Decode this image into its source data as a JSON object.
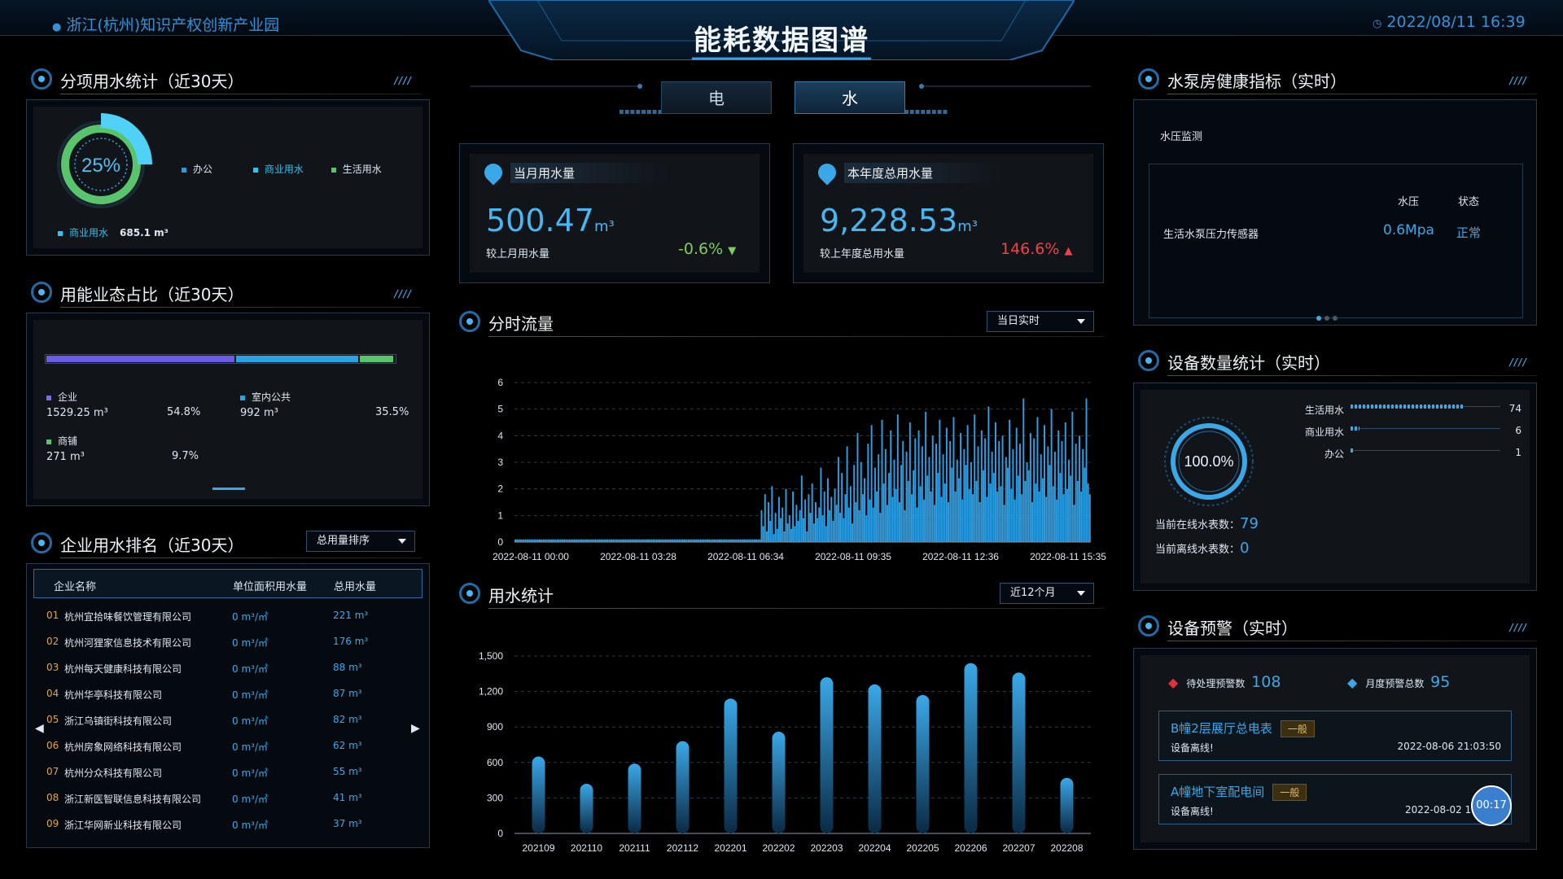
{
  "header": {
    "location": "浙江(杭州)知识产权创新产业园",
    "title": "能耗数据图谱",
    "datetime": "2022/08/11 16:39"
  },
  "tabs": [
    {
      "label": "电",
      "active": false
    },
    {
      "label": "水",
      "active": true
    }
  ],
  "sub_water": {
    "title": "分项用水统计（近30天）",
    "percent": "25%",
    "percent_value": 25,
    "legend": [
      {
        "label": "办公",
        "color": "#2f9ae0"
      },
      {
        "label": "商业用水",
        "color": "#2fc4ef"
      },
      {
        "label": "生活用水",
        "color": "#58c46c"
      }
    ],
    "detail_label": "商业用水",
    "detail_value": "685.1 m³"
  },
  "energy_ratio": {
    "title": "用能业态占比（近30天）",
    "bar_fractions": [
      0.548,
      0.355,
      0.097
    ],
    "bar_colors": [
      "#6a5ce8",
      "#2aa3e6",
      "#58c46c"
    ],
    "items": [
      {
        "label": "企业",
        "value": "1529.25 m³",
        "pct": "54.8%",
        "color": "#7a6ef0"
      },
      {
        "label": "室内公共",
        "value": "992 m³",
        "pct": "35.5%",
        "color": "#2aa3e6"
      },
      {
        "label": "商铺",
        "value": "271 m³",
        "pct": "9.7%",
        "color": "#58c46c"
      }
    ]
  },
  "ranking": {
    "title": "企业用水排名（近30天）",
    "sort_label": "总用量排序",
    "columns": [
      "企业名称",
      "单位面积用水量",
      "总用水量"
    ],
    "rows": [
      {
        "rank": "01",
        "name": "杭州宜拾味餐饮管理有限公司",
        "per_area": "0 m³/㎡",
        "total": "221 m³"
      },
      {
        "rank": "02",
        "name": "杭州河狸家信息技术有限公司",
        "per_area": "0 m³/㎡",
        "total": "176 m³"
      },
      {
        "rank": "03",
        "name": "杭州每天健康科技有限公司",
        "per_area": "0 m³/㎡",
        "total": "88 m³"
      },
      {
        "rank": "04",
        "name": "杭州华亭科技有限公司",
        "per_area": "0 m³/㎡",
        "total": "87 m³"
      },
      {
        "rank": "05",
        "name": "浙江乌镇街科技有限公司",
        "per_area": "0 m³/㎡",
        "total": "82 m³"
      },
      {
        "rank": "06",
        "name": "杭州房象网络科技有限公司",
        "per_area": "0 m³/㎡",
        "total": "62 m³"
      },
      {
        "rank": "07",
        "name": "杭州分众科技有限公司",
        "per_area": "0 m³/㎡",
        "total": "55 m³"
      },
      {
        "rank": "08",
        "name": "浙江新医智联信息科技有限公司",
        "per_area": "0 m³/㎡",
        "total": "41 m³"
      },
      {
        "rank": "09",
        "name": "浙江华网新业科技有限公司",
        "per_area": "0 m³/㎡",
        "total": "37 m³"
      }
    ]
  },
  "kpis": [
    {
      "label": "当月用水量",
      "value": "500.47",
      "unit": "m³",
      "compare_label": "较上月用水量",
      "change": "-0.6%",
      "change_color": "#7ccf5c",
      "arrow": "▼"
    },
    {
      "label": "本年度总用水量",
      "value": "9,228.53",
      "unit": "m³",
      "compare_label": "较上年度总用水量",
      "change": "146.6%",
      "change_color": "#f0404a",
      "arrow": "▲"
    }
  ],
  "hourly": {
    "title": "分时流量",
    "select_label": "当日实时"
  },
  "usage_stats": {
    "title": "用水统计",
    "select_label": "近12个月"
  },
  "pump": {
    "title": "水泵房健康指标（实时）",
    "section_label": "水压监测",
    "col_pressure": "水压",
    "col_status": "状态",
    "sensor_name": "生活水泵压力传感器",
    "pressure": "0.6Mpa",
    "status": "正常"
  },
  "devices": {
    "title": "设备数量统计（实时）",
    "ring_label": "100.0%",
    "bars": [
      {
        "label": "生活用水",
        "count": "74",
        "fraction": 0.74
      },
      {
        "label": "商业用水",
        "count": "6",
        "fraction": 0.06
      },
      {
        "label": "办公",
        "count": "1",
        "fraction": 0.01
      }
    ],
    "online_label": "当前在线水表数：",
    "online_value": "79",
    "offline_label": "当前离线水表数：",
    "offline_value": "0"
  },
  "alerts": {
    "title": "设备预警（实时）",
    "pending_label": "待处理预警数",
    "pending_value": "108",
    "monthly_label": "月度预警总数",
    "monthly_value": "95",
    "items": [
      {
        "name": "B幢2层展厅总电表",
        "level": "一般",
        "message": "设备离线!",
        "time": "2022-08-06 21:03:50"
      },
      {
        "name": "A幢地下室配电间",
        "level": "一般",
        "message": "设备离线!",
        "time": "2022-08-02 18:"
      }
    ],
    "timer": "00:17"
  },
  "chart_data": [
    {
      "type": "bar",
      "title": "分时流量",
      "x_tick_labels": [
        "2022-08-11 00:00",
        "2022-08-11 03:28",
        "2022-08-11 06:34",
        "2022-08-11 09:35",
        "2022-08-11 12:36",
        "2022-08-11 15:35"
      ],
      "ylim": [
        0,
        6
      ],
      "yticks": [
        0,
        1,
        2,
        3,
        4,
        5,
        6
      ],
      "grid": true,
      "x_range": [
        "2022-08-11 00:00",
        "2022-08-11 16:10"
      ],
      "values": [
        0.1,
        0.1,
        0.1,
        0.1,
        0.1,
        0.1,
        0.1,
        0.1,
        0.1,
        0.1,
        0.1,
        0.1,
        0.1,
        0.1,
        0.1,
        0.1,
        0.1,
        0.1,
        0.1,
        0.1,
        0.1,
        0.1,
        0.1,
        0.1,
        0.1,
        0.1,
        0.1,
        0.1,
        0.1,
        0.1,
        0.1,
        0.1,
        0.1,
        0.1,
        0.1,
        0.1,
        0.1,
        0.1,
        0.1,
        0.1,
        0.1,
        0.1,
        0.1,
        0.1,
        0.1,
        0.1,
        0.1,
        0.1,
        0.1,
        0.1,
        0.1,
        0.1,
        0.1,
        0.1,
        0.1,
        0.1,
        0.1,
        0.1,
        0.1,
        0.1,
        0.1,
        0.1,
        0.1,
        0.1,
        0.1,
        0.1,
        0.1,
        0.1,
        0.1,
        0.1,
        0.1,
        0.1,
        0.1,
        0.1,
        0.1,
        0.1,
        0.1,
        0.1,
        0.1,
        0.1,
        0.1,
        0.1,
        0.1,
        0.1,
        0.1,
        0.1,
        0.1,
        0.1,
        0.1,
        0.1,
        0.1,
        0.1,
        0.1,
        0.1,
        0.1,
        0.1,
        0.1,
        0.1,
        0.1,
        0.1,
        0.1,
        0.1,
        0.1,
        0.1,
        0.1,
        0.1,
        0.1,
        0.1,
        0.1,
        0.1,
        0.1,
        0.1,
        0.1,
        0.1,
        0.1,
        0.1,
        0.1,
        0.1,
        0.1,
        0.1,
        0.1,
        0.1,
        0.1,
        0.1,
        0.1,
        0.1,
        0.1,
        0.1,
        0.1,
        0.1,
        0.1,
        0.1,
        0.1,
        0.1,
        0.1,
        0.1,
        0.1,
        0.1,
        0.1,
        0.1,
        0.1,
        1.2,
        0.6,
        1.8,
        0.4,
        1.5,
        0.8,
        2.1,
        0.3,
        1.1,
        0.5,
        1.7,
        0.9,
        1.3,
        0.4,
        2.0,
        0.7,
        1.0,
        0.5,
        1.9,
        0.6,
        1.4,
        0.8,
        1.2,
        2.5,
        0.9,
        1.6,
        0.4,
        1.8,
        1.1,
        2.2,
        0.7,
        1.5,
        0.9,
        1.3,
        2.8,
        1.0,
        1.9,
        0.6,
        2.4,
        1.2,
        1.7,
        0.8,
        2.0,
        1.4,
        3.2,
        1.1,
        2.6,
        0.9,
        1.8,
        3.6,
        1.3,
        2.1,
        0.7,
        2.9,
        1.5,
        4.1,
        1.2,
        3.0,
        1.8,
        2.4,
        1.0,
        3.7,
        1.6,
        4.4,
        1.3,
        2.8,
        1.9,
        3.3,
        1.1,
        4.6,
        2.2,
        3.5,
        1.4,
        2.6,
        4.2,
        1.7,
        3.1,
        2.0,
        4.8,
        1.5,
        2.9,
        3.8,
        1.2,
        3.4,
        2.3,
        4.5,
        1.8,
        2.7,
        3.9,
        1.3,
        4.2,
        2.1,
        3.6,
        1.6,
        4.9,
        2.5,
        3.2,
        1.9,
        4.0,
        1.4,
        3.7,
        2.6,
        4.6,
        1.7,
        3.3,
        2.2,
        4.3,
        1.5,
        3.8,
        2.8,
        4.7,
        1.9,
        3.1,
        2.4,
        4.1,
        1.6,
        3.5,
        2.9,
        4.4,
        2.0,
        3.0,
        1.8,
        4.8,
        2.3,
        3.6,
        1.5,
        4.2,
        2.7,
        3.9,
        1.7,
        5.1,
        2.2,
        3.4,
        2.6,
        4.5,
        1.9,
        3.8,
        2.1,
        4.0,
        1.4,
        3.2,
        2.8,
        4.6,
        2.0,
        3.5,
        1.6,
        4.3,
        2.5,
        3.7,
        1.8,
        5.4,
        2.3,
        3.0,
        2.7,
        4.1,
        1.5,
        3.9,
        2.2,
        4.7,
        1.9,
        3.3,
        2.4,
        4.4,
        1.7,
        3.6,
        2.9,
        5.0,
        2.1,
        3.4,
        1.6,
        4.2,
        2.6,
        3.8,
        1.8,
        4.5,
        2.0,
        3.1,
        2.5,
        4.9,
        1.4,
        3.7,
        2.3,
        4.0,
        1.9,
        3.5,
        2.8,
        5.4,
        2.2,
        1.8
      ]
    },
    {
      "type": "bar",
      "title": "用水统计",
      "categories": [
        "202109",
        "202110",
        "202111",
        "202112",
        "202201",
        "202202",
        "202203",
        "202204",
        "202205",
        "202206",
        "202207",
        "202208"
      ],
      "values": [
        650,
        420,
        590,
        780,
        1140,
        860,
        1320,
        1260,
        1170,
        1440,
        1360,
        470
      ],
      "ylim": [
        0,
        1500
      ],
      "yticks": [
        0,
        300,
        600,
        900,
        1200,
        1500
      ],
      "grid": true
    }
  ]
}
